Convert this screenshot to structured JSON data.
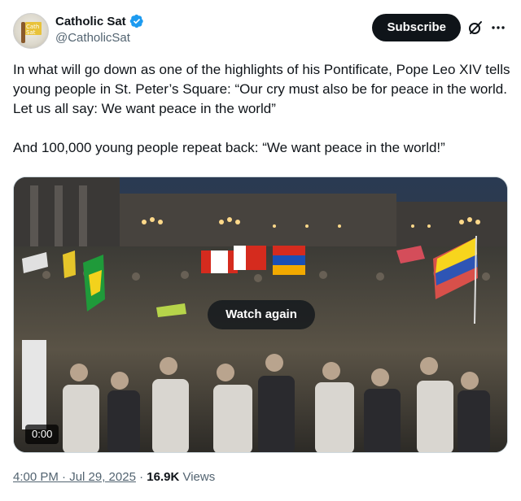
{
  "account": {
    "display_name": "Catholic Sat",
    "handle": "@CatholicSat",
    "avatar_text": "Catholic Sat",
    "verified": true
  },
  "actions": {
    "subscribe_label": "Subscribe",
    "grok_icon": "grok-icon",
    "more_icon": "more-icon"
  },
  "tweet": {
    "paragraph_1": "In what will go down as one of the highlights of his Pontificate, Pope Leo XIV tells young people in St. Peter’s Square: “Our cry must also be for peace in the world. Let us all say: We want peace in the world”",
    "paragraph_2": "And 100,000 young people repeat back: “We want peace in the world!”"
  },
  "video": {
    "watch_again_label": "Watch again",
    "timestamp": "0:00"
  },
  "meta": {
    "time": "4:00 PM · Jul 29, 2025",
    "separator": "·",
    "views_count": "16.9K",
    "views_label": "Views"
  },
  "colors": {
    "text_primary": "#0f1419",
    "text_secondary": "#536471",
    "verified_blue": "#1d9bf0",
    "button_bg": "#0f1419"
  }
}
